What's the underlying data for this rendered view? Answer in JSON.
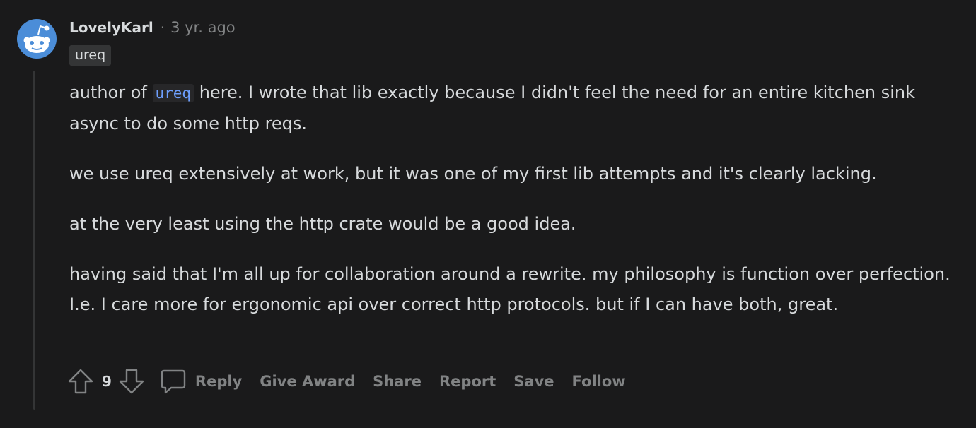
{
  "comment": {
    "author": "LovelyKarl",
    "separator": "·",
    "time": "3 yr. ago",
    "flair": "ureq",
    "body": {
      "p1_before": "author of",
      "p1_code": "ureq",
      "p1_after": "here. I wrote that lib exactly because I didn't feel the need for an entire kitchen sink async to do some http reqs.",
      "p2": "we use ureq extensively at work, but it was one of my first lib attempts and it's clearly lacking.",
      "p3": "at the very least using the http crate would be a good idea.",
      "p4": "having said that I'm all up for collaboration around a rewrite. my philosophy is function over perfection. I.e. I care more for ergonomic api over correct http protocols. but if I can have both, great."
    }
  },
  "actions": {
    "score": "9",
    "reply": "Reply",
    "give_award": "Give Award",
    "share": "Share",
    "report": "Report",
    "save": "Save",
    "follow": "Follow"
  },
  "colors": {
    "background": "#1a1a1b",
    "text": "#d7dadc",
    "muted": "#818384",
    "code": "#6d9efc",
    "avatar": "#4b8dd8"
  },
  "icons": {
    "avatar": "snoo-avatar-icon",
    "upvote": "upvote-arrow-icon",
    "downvote": "downvote-arrow-icon",
    "reply": "speech-bubble-icon"
  }
}
